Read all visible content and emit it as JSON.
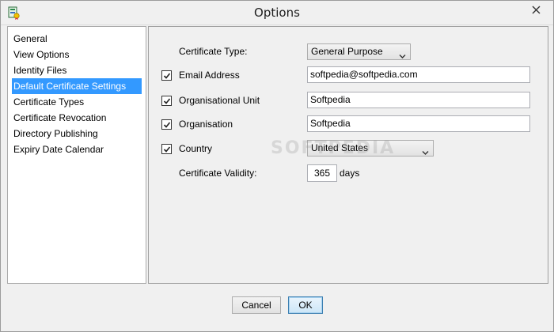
{
  "window": {
    "title": "Options"
  },
  "nav": {
    "items": [
      {
        "label": "General"
      },
      {
        "label": "View Options"
      },
      {
        "label": "Identity Files"
      },
      {
        "label": "Default Certificate Settings"
      },
      {
        "label": "Certificate Types"
      },
      {
        "label": "Certificate Revocation"
      },
      {
        "label": "Directory Publishing"
      },
      {
        "label": "Expiry Date Calendar"
      }
    ],
    "selected": "Default Certificate Settings"
  },
  "form": {
    "certificate_type": {
      "label": "Certificate Type:",
      "value": "General Purpose"
    },
    "email": {
      "label": "Email Address",
      "checked": true,
      "value": "softpedia@softpedia.com"
    },
    "org_unit": {
      "label": "Organisational Unit",
      "checked": true,
      "value": "Softpedia"
    },
    "organisation": {
      "label": "Organisation",
      "checked": true,
      "value": "Softpedia"
    },
    "country": {
      "label": "Country",
      "checked": true,
      "value": "United States"
    },
    "validity": {
      "label": "Certificate Validity:",
      "value": "365",
      "unit": "days"
    }
  },
  "watermark": "SOFTPEDIA",
  "buttons": {
    "cancel": "Cancel",
    "ok": "OK"
  },
  "icons": {
    "app": "app-icon",
    "close": "close-icon",
    "check": "checkmark-icon",
    "dropdown": "chevron-down-icon"
  }
}
